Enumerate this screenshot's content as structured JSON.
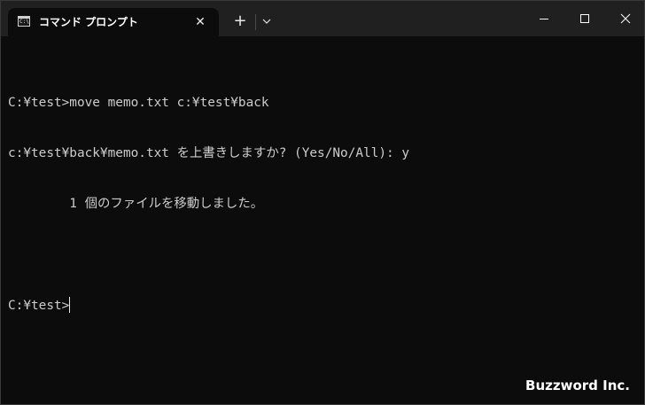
{
  "window": {
    "tab_title": "コマンド プロンプト",
    "tab_icon": "cmd-prompt-icon",
    "tab_icon_glyph": "C:\\",
    "close_tab_symbol": "✕",
    "new_tab_symbol": "+",
    "controls": [
      "minimize-icon",
      "maximize-icon",
      "close-icon"
    ]
  },
  "terminal": {
    "lines": [
      "C:¥test>move memo.txt c:¥test¥back",
      "c:¥test¥back¥memo.txt を上書きしますか? (Yes/No/All): y",
      "        1 個のファイルを移動しました。",
      "",
      "C:¥test>"
    ]
  },
  "watermark": "Buzzword Inc.",
  "colors": {
    "titlebar": "#202020",
    "terminal_bg": "#0c0c0c",
    "terminal_text": "#cccccc",
    "active_tab": "#0c0c0c"
  }
}
